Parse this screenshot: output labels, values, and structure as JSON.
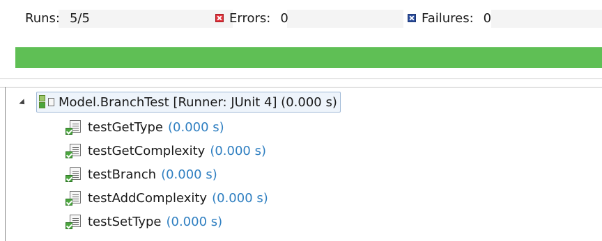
{
  "stats": {
    "runs_label": "Runs:",
    "runs_value": "5/5",
    "errors_label": "Errors:",
    "errors_value": "0",
    "failures_label": "Failures:",
    "failures_value": "0"
  },
  "progress": {
    "fraction": 1.0,
    "color": "#5fbf55"
  },
  "tree": {
    "root": {
      "label": "Model.BranchTest [Runner: JUnit 4] (0.000 s)",
      "icon": "test-suite-success-icon"
    },
    "tests": [
      {
        "name": "testGetType",
        "time": "(0.000 s)",
        "icon": "test-success-icon"
      },
      {
        "name": "testGetComplexity",
        "time": "(0.000 s)",
        "icon": "test-success-icon"
      },
      {
        "name": "testBranch",
        "time": "(0.000 s)",
        "icon": "test-success-icon"
      },
      {
        "name": "testAddComplexity",
        "time": "(0.000 s)",
        "icon": "test-success-icon"
      },
      {
        "name": "testSetType",
        "time": "(0.000 s)",
        "icon": "test-success-icon"
      }
    ]
  },
  "colors": {
    "time_text": "#2f7fc1",
    "error_icon": "#e2313a",
    "failure_icon": "#2d4f9e"
  }
}
